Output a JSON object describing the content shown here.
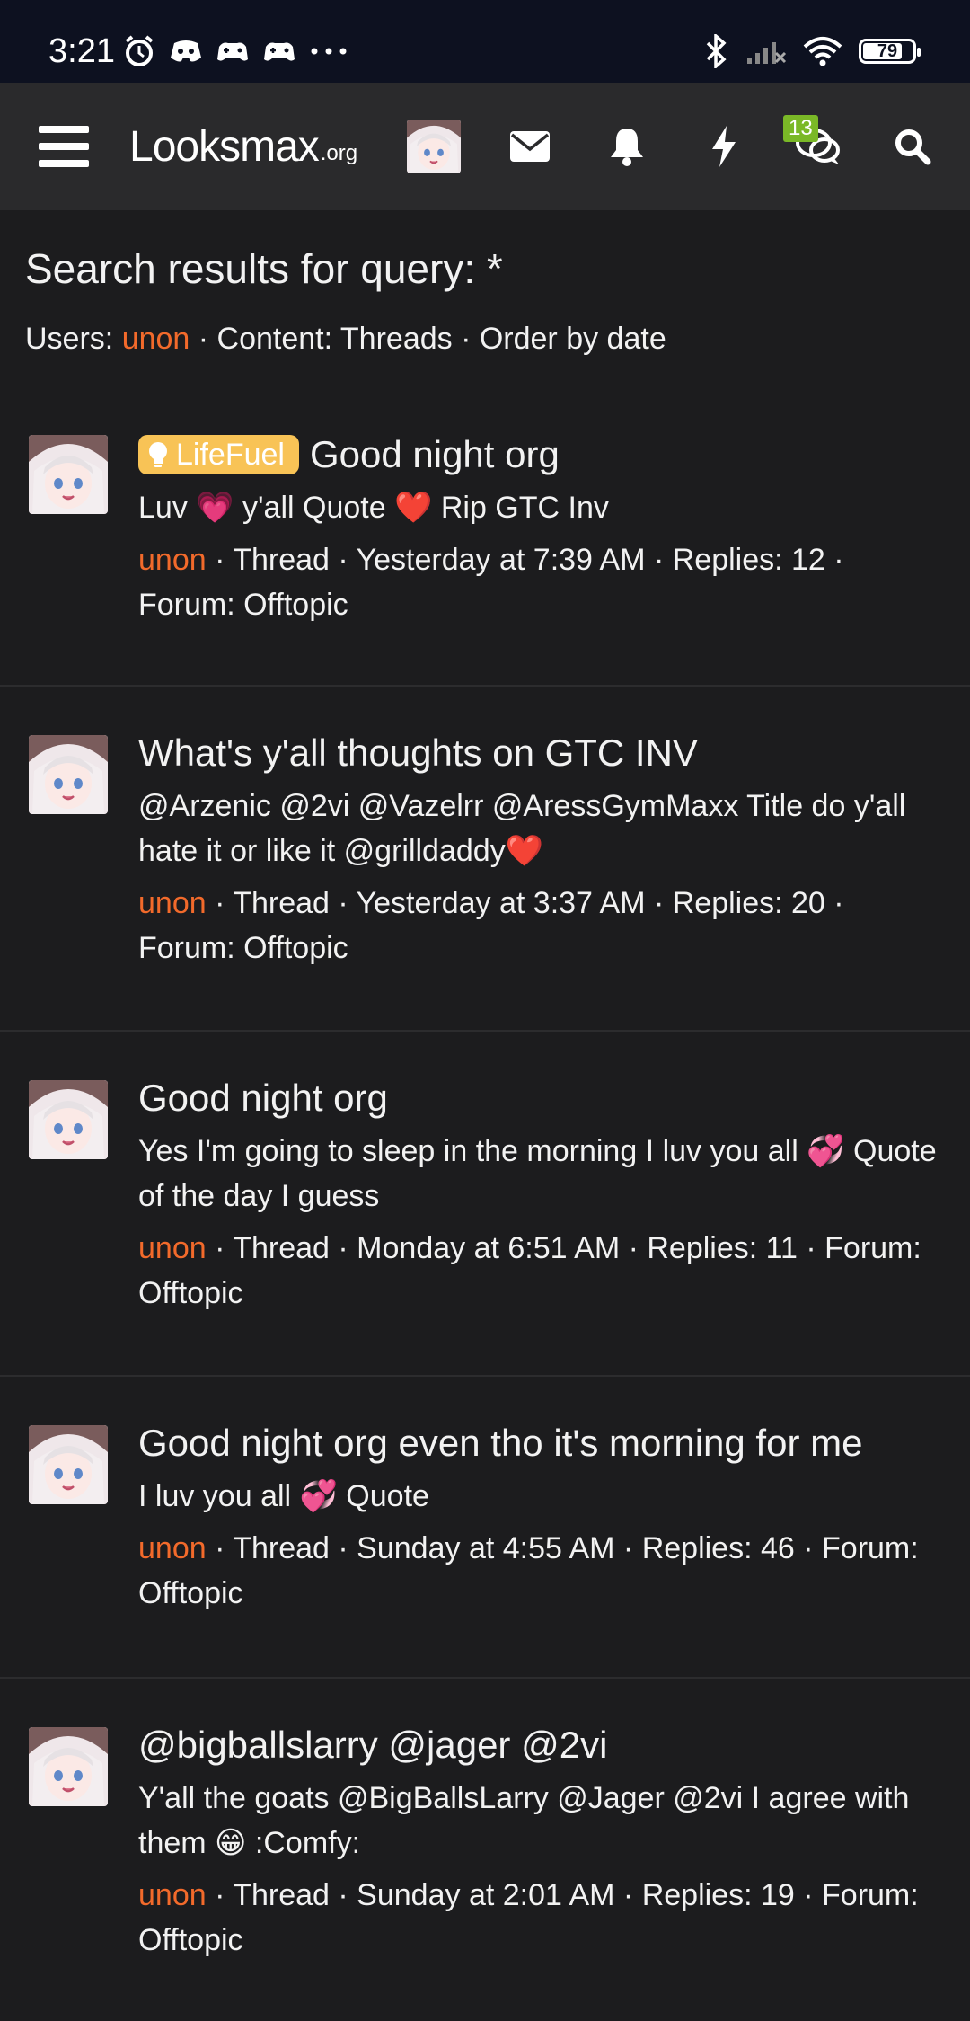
{
  "status_bar": {
    "time": "3:21",
    "battery": "79",
    "battery_level": 0.79
  },
  "nav": {
    "logo_main": "Looksmax",
    "logo_tld": ".org",
    "conversations_badge": "13",
    "icons": [
      "menu-icon",
      "avatar",
      "envelope-icon",
      "bell-icon",
      "bolt-icon",
      "chat-icon",
      "search-icon"
    ]
  },
  "page": {
    "title": "Search results for query: *",
    "filters": {
      "users_label": "Users:",
      "user": "unon",
      "rest": " · Content: Threads · Order by date"
    }
  },
  "results": [
    {
      "prefix": "LifeFuel",
      "title": "Good night org",
      "snippet": "Luv 💗 y'all Quote ❤️ Rip GTC Inv",
      "author": "unon",
      "meta": " · Thread · Yesterday at 7:39 AM · Replies: 12 · Forum: Offtopic"
    },
    {
      "prefix": "",
      "title": "What's y'all thoughts on GTC INV",
      "snippet": "@Arzenic @2vi @Vazelrr @AressGymMaxx Title do y'all hate it or like it @grilldaddy❤️",
      "author": "unon",
      "meta": " · Thread · Yesterday at 3:37 AM · Replies: 20 · Forum: Offtopic"
    },
    {
      "prefix": "",
      "title": "Good night org",
      "snippet": "Yes I'm going to sleep in the morning I luv you all 💞 Quote of the day I guess",
      "author": "unon",
      "meta": " · Thread · Monday at 6:51 AM · Replies: 11 · Forum: Offtopic"
    },
    {
      "prefix": "",
      "title": "Good night org even tho it's morning for me",
      "snippet": "I luv you all 💞 Quote",
      "author": "unon",
      "meta": " · Thread · Sunday at 4:55 AM · Replies: 46 · Forum: Offtopic"
    },
    {
      "prefix": "",
      "title": "@bigballslarry @jager @2vi",
      "snippet": "Y'all the goats @BigBallsLarry @Jager @2vi I agree with them 😁 :Comfy:",
      "author": "unon",
      "meta": " · Thread · Sunday at 2:01 AM · Replies: 19 · Forum: Offtopic"
    }
  ],
  "colors": {
    "background": "#1c1c1e",
    "nav_bg": "#2a2a2c",
    "status_bg": "#0d1120",
    "username": "#f26a2b",
    "prefix_bg": "#f8c356",
    "badge_bg": "#7ab827"
  }
}
